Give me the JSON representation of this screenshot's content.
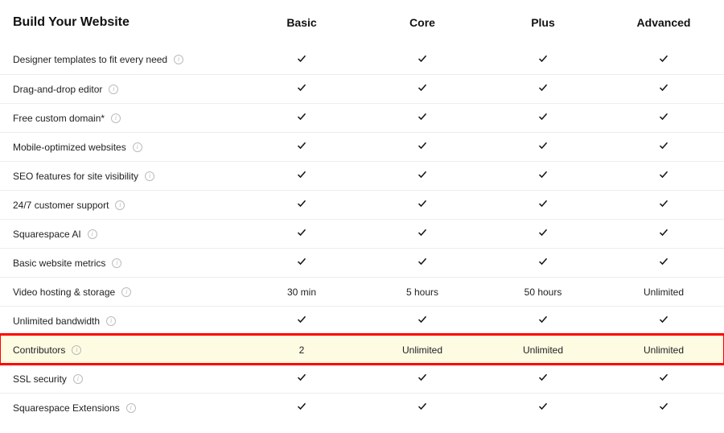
{
  "title": "Build Your Website",
  "plans": [
    "Basic",
    "Core",
    "Plus",
    "Advanced"
  ],
  "check": "check",
  "rows": [
    {
      "label": "Designer templates to fit every need",
      "values": [
        "check",
        "check",
        "check",
        "check"
      ],
      "highlight": false
    },
    {
      "label": "Drag-and-drop editor",
      "values": [
        "check",
        "check",
        "check",
        "check"
      ],
      "highlight": false
    },
    {
      "label": "Free custom domain*",
      "values": [
        "check",
        "check",
        "check",
        "check"
      ],
      "highlight": false
    },
    {
      "label": "Mobile-optimized websites",
      "values": [
        "check",
        "check",
        "check",
        "check"
      ],
      "highlight": false
    },
    {
      "label": "SEO features for site visibility",
      "values": [
        "check",
        "check",
        "check",
        "check"
      ],
      "highlight": false
    },
    {
      "label": "24/7 customer support",
      "values": [
        "check",
        "check",
        "check",
        "check"
      ],
      "highlight": false
    },
    {
      "label": "Squarespace AI",
      "values": [
        "check",
        "check",
        "check",
        "check"
      ],
      "highlight": false
    },
    {
      "label": "Basic website metrics",
      "values": [
        "check",
        "check",
        "check",
        "check"
      ],
      "highlight": false
    },
    {
      "label": "Video hosting & storage",
      "values": [
        "30 min",
        "5 hours",
        "50 hours",
        "Unlimited"
      ],
      "highlight": false
    },
    {
      "label": "Unlimited bandwidth",
      "values": [
        "check",
        "check",
        "check",
        "check"
      ],
      "highlight": false
    },
    {
      "label": "Contributors",
      "values": [
        "2",
        "Unlimited",
        "Unlimited",
        "Unlimited"
      ],
      "highlight": true
    },
    {
      "label": "SSL security",
      "values": [
        "check",
        "check",
        "check",
        "check"
      ],
      "highlight": false
    },
    {
      "label": "Squarespace Extensions",
      "values": [
        "check",
        "check",
        "check",
        "check"
      ],
      "highlight": false
    }
  ]
}
